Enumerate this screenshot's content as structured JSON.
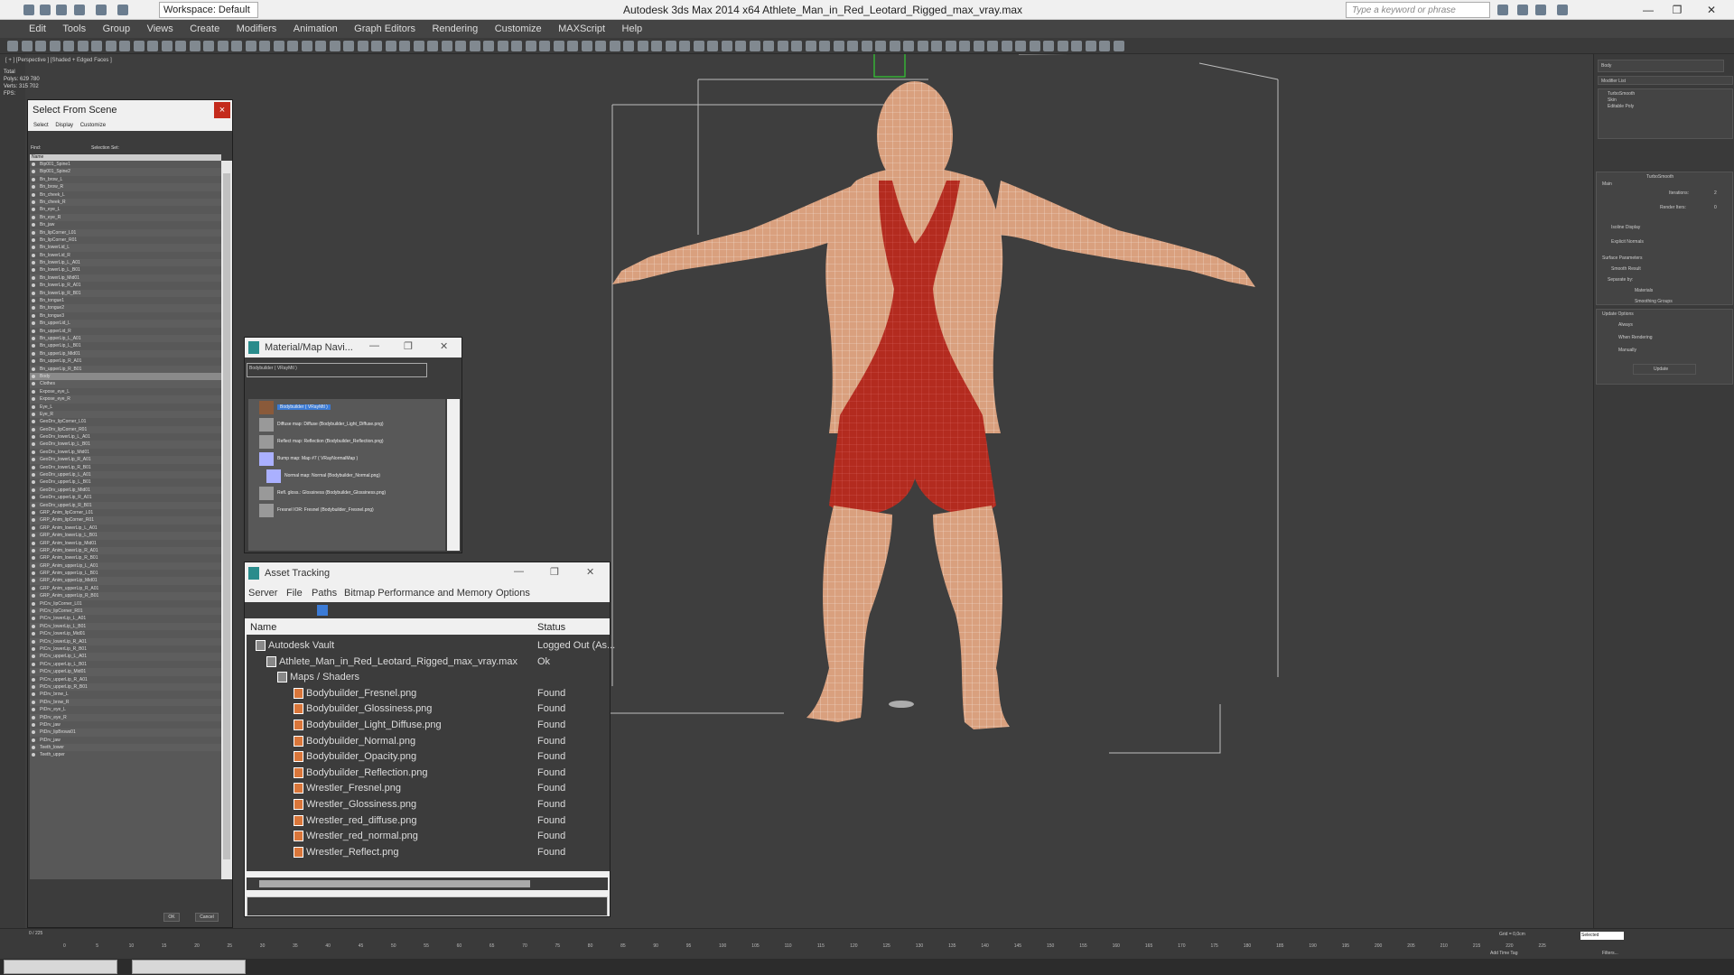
{
  "titlebar": {
    "workspace": "Workspace: Default",
    "app_title": "Autodesk 3ds Max  2014 x64     Athlete_Man_in_Red_Leotard_Rigged_max_vray.max",
    "search_placeholder": "Type a keyword or phrase",
    "min_icon": "minimize-icon",
    "max_icon": "maximize-icon",
    "close_icon": "close-icon"
  },
  "menubar": [
    "Edit",
    "Tools",
    "Group",
    "Views",
    "Create",
    "Modifiers",
    "Animation",
    "Graph Editors",
    "Rendering",
    "Customize",
    "MAXScript",
    "Help"
  ],
  "viewport": {
    "label": "[ + ] [Perspective ] [Shaded + Edged Faces ]",
    "stats": [
      "Total",
      "Polys:  629 780",
      "Verts:  315 702",
      "",
      "FPS:"
    ]
  },
  "select_from_scene": {
    "title": "Select From Scene",
    "close": "×",
    "menu": [
      "Select",
      "Display",
      "Customize"
    ],
    "find_label": "Find:",
    "selection_set": "Selection Set:",
    "column": "Name",
    "items": [
      "Bip001_Spine1",
      "Bip001_Spine2",
      "Bn_brow_L",
      "Bn_brow_R",
      "Bn_cheek_L",
      "Bn_cheek_R",
      "Bn_eye_L",
      "Bn_eye_R",
      "Bn_jaw",
      "Bn_lipCorner_L01",
      "Bn_lipCorner_R01",
      "Bn_lowerLid_L",
      "Bn_lowerLid_R",
      "Bn_lowerLip_L_A01",
      "Bn_lowerLip_L_B01",
      "Bn_lowerLip_Mid01",
      "Bn_lowerLip_R_A01",
      "Bn_lowerLip_R_B01",
      "Bn_tongue1",
      "Bn_tongue2",
      "Bn_tongue3",
      "Bn_upperLid_L",
      "Bn_upperLid_R",
      "Bn_upperLip_L_A01",
      "Bn_upperLip_L_B01",
      "Bn_upperLip_Mid01",
      "Bn_upperLip_R_A01",
      "Bn_upperLip_R_B01",
      "Body",
      "Clothes",
      "Expose_eye_L",
      "Expose_eye_R",
      "Eye_L",
      "Eye_R",
      "GeoDrv_lipCorner_L01",
      "GeoDrv_lipCorner_R01",
      "GeoDrv_lowerLip_L_A01",
      "GeoDrv_lowerLip_L_B01",
      "GeoDrv_lowerLip_Mid01",
      "GeoDrv_lowerLip_R_A01",
      "GeoDrv_lowerLip_R_B01",
      "GeoDrv_upperLip_L_A01",
      "GeoDrv_upperLip_L_B01",
      "GeoDrv_upperLip_Mid01",
      "GeoDrv_upperLip_R_A01",
      "GeoDrv_upperLip_R_B01",
      "GRP_Anim_lipCorner_L01",
      "GRP_Anim_lipCorner_R01",
      "GRP_Anim_lowerLip_L_A01",
      "GRP_Anim_lowerLip_L_B01",
      "GRP_Anim_lowerLip_Mid01",
      "GRP_Anim_lowerLip_R_A01",
      "GRP_Anim_lowerLip_R_B01",
      "GRP_Anim_upperLip_L_A01",
      "GRP_Anim_upperLip_L_B01",
      "GRP_Anim_upperLip_Mid01",
      "GRP_Anim_upperLip_R_A01",
      "GRP_Anim_upperLip_R_B01",
      "PtCrv_lipCorner_L01",
      "PtCrv_lipCorner_R01",
      "PtCrv_lowerLip_L_A01",
      "PtCrv_lowerLip_L_B01",
      "PtCrv_lowerLip_Mid01",
      "PtCrv_lowerLip_R_A01",
      "PtCrv_lowerLip_R_B01",
      "PtCrv_upperLip_L_A01",
      "PtCrv_upperLip_L_B01",
      "PtCrv_upperLip_Mid01",
      "PtCrv_upperLip_R_A01",
      "PtCrv_upperLip_R_B01",
      "PtDrv_brow_L",
      "PtDrv_brow_R",
      "PtDrv_eye_L",
      "PtDrv_eye_R",
      "PtDrv_jaw",
      "PtDrv_lipBrows01",
      "PtDrv_jaw",
      "Teeth_lower",
      "Teeth_upper"
    ],
    "selected": "Body",
    "ok": "OK",
    "cancel": "Cancel"
  },
  "material_nav": {
    "title": "Material/Map Navi...",
    "field": "Bodybuilder  ( VRayMtl )",
    "nodes": [
      {
        "label": "Bodybuilder  ( VRayMtl )",
        "selected": true
      },
      {
        "label": "Diffuse map: Diffuse (Bodybuilder_Light_Diffuse.png)",
        "selected": false
      },
      {
        "label": "Reflect map: Reflection (Bodybuilder_Reflection.png)",
        "selected": false
      },
      {
        "label": "Bump map: Map #7  ( VRayNormalMap )",
        "selected": false
      },
      {
        "label": "Normal map: Normal (Bodybuilder_Normal.png)",
        "selected": false
      },
      {
        "label": "Refl. gloss.: Glossiness (Bodybuilder_Glossiness.png)",
        "selected": false
      },
      {
        "label": "Fresnel IOR: Fresnel (Bodybuilder_Fresnel.png)",
        "selected": false
      }
    ]
  },
  "asset_tracking": {
    "title": "Asset Tracking",
    "menu": [
      "Server",
      "File",
      "Paths",
      "Bitmap Performance and Memory",
      "Options"
    ],
    "col_name": "Name",
    "col_status": "Status",
    "rows": [
      {
        "name": "Autodesk Vault",
        "status": "Logged Out (As..."
      },
      {
        "name": "Athlete_Man_in_Red_Leotard_Rigged_max_vray.max",
        "status": "Ok"
      },
      {
        "name": "Maps / Shaders",
        "status": ""
      },
      {
        "name": "Bodybuilder_Fresnel.png",
        "status": "Found"
      },
      {
        "name": "Bodybuilder_Glossiness.png",
        "status": "Found"
      },
      {
        "name": "Bodybuilder_Light_Diffuse.png",
        "status": "Found"
      },
      {
        "name": "Bodybuilder_Normal.png",
        "status": "Found"
      },
      {
        "name": "Bodybuilder_Opacity.png",
        "status": "Found"
      },
      {
        "name": "Bodybuilder_Reflection.png",
        "status": "Found"
      },
      {
        "name": "Wrestler_Fresnel.png",
        "status": "Found"
      },
      {
        "name": "Wrestler_Glossiness.png",
        "status": "Found"
      },
      {
        "name": "Wrestler_red_diffuse.png",
        "status": "Found"
      },
      {
        "name": "Wrestler_red_normal.png",
        "status": "Found"
      },
      {
        "name": "Wrestler_Reflect.png",
        "status": "Found"
      }
    ]
  },
  "command_panel": {
    "name_field": "Body",
    "modifier_list": "Modifier List",
    "stack": [
      "TurboSmooth",
      "Skin",
      "Editable Poly"
    ],
    "rollout": "TurboSmooth",
    "main": "Main",
    "iterations_label": "Iterations:",
    "iterations": "2",
    "render_iters_label": "Render Iters:",
    "render_iters": "0",
    "isoline": "Isoline Display",
    "explicit": "Explicit Normals",
    "surface": "Surface Parameters",
    "smooth": "Smooth Result",
    "separate": "Separate by:",
    "materials": "Materials",
    "smoothing": "Smoothing Groups",
    "update_opts": "Update Options",
    "always": "Always",
    "when_render": "When Rendering",
    "manually": "Manually",
    "update": "Update"
  },
  "timeline": {
    "frame": "0 / 225",
    "ticks": [
      "0",
      "5",
      "10",
      "15",
      "20",
      "25",
      "30",
      "35",
      "40",
      "45",
      "50",
      "55",
      "60",
      "65",
      "70",
      "75",
      "80",
      "85",
      "90",
      "95",
      "100",
      "105",
      "110",
      "115",
      "120",
      "125",
      "130",
      "135",
      "140",
      "145",
      "150",
      "155",
      "160",
      "165",
      "170",
      "175",
      "180",
      "185",
      "190",
      "195",
      "200",
      "205",
      "210",
      "215",
      "220",
      "225"
    ],
    "grid": "Grid = 0,0cm",
    "add_time_tag": "Add Time Tag",
    "selected": "Selected",
    "filters": "Filters..."
  },
  "colors": {
    "leotard": "#b32b1f",
    "skin": "#d9a07e",
    "viewport_bg": "#3e3e3e"
  }
}
